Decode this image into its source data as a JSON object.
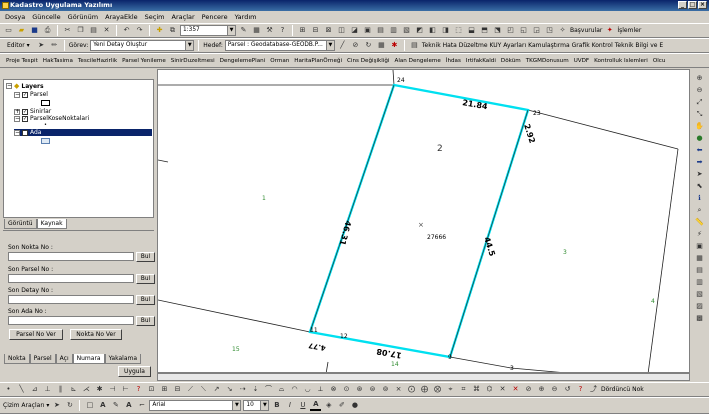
{
  "app": {
    "title": "Kadastro Uygulama Yazılımı"
  },
  "menu": [
    "Dosya",
    "Güncelle",
    "Görünüm",
    "ArayaEkle",
    "Seçim",
    "Araçlar",
    "Pencere",
    "Yardım"
  ],
  "toolbar1": {
    "scale": "1:357",
    "basvurular": "Başvurular",
    "islemler": "İşlemler"
  },
  "toolbar2": {
    "editor": "Editor ▾",
    "gorev_label": "Görev:",
    "gorev_value": "Yeni Detay Oluştur",
    "hedef_label": "Hedef:",
    "hedef_value": "Parsel : Geodatabase-GEODB.P...",
    "links": [
      "Teknik Hata Düzeltme",
      "KUY Ayarları",
      "Kamulaştırma",
      "Grafik Kontrol",
      "Teknik Bilgi ve E"
    ]
  },
  "toolbar3": [
    "Proje Tespit",
    "HakTasima",
    "TescileHazirlik",
    "Parsel Yenileme",
    "SinirDuzeltmesi",
    "DengelemePlani",
    "Orman",
    "HaritaPlanÖrneği",
    "Cins Değişikliği",
    "Alan Dengeleme",
    "İhdas",
    "IrtifakKaldi",
    "Döküm",
    "TKGMDonusum",
    "UVDF",
    "Kontrolluk Islemleri",
    "Olcu"
  ],
  "toc": {
    "root": "Layers",
    "layers": [
      {
        "name": "Parsel",
        "checked": true
      },
      {
        "name": "Sinirlar",
        "checked": true
      },
      {
        "name": "ParselKoseNoktalari",
        "checked": true
      },
      {
        "name": "Ada",
        "checked": true,
        "selected": true
      }
    ],
    "tabs": [
      "Görüntü",
      "Kaynak"
    ]
  },
  "form": {
    "labels": [
      "Son Nokta No :",
      "Son Parsel No :",
      "Son Detay No :",
      "Son Ada No :"
    ],
    "bul": "Bul",
    "parsel_no_ver": "Parsel No Ver",
    "nokta_no_ver": "Nokta No Ver",
    "tabs": [
      "Nokta",
      "Parsel",
      "Açı",
      "Numara",
      "Yakalama"
    ],
    "uygula": "Uygula"
  },
  "map": {
    "parcel_labels": [
      "1",
      "2",
      "3",
      "4",
      "14",
      "15"
    ],
    "points": [
      "24",
      "23",
      "11",
      "12",
      "9",
      "3"
    ],
    "dimensions": {
      "top": "21.84",
      "right_top": "2.92",
      "left": "46.31",
      "right": "44.5",
      "bottom": "17.08",
      "bottom_left": "4.77"
    },
    "area_id": "27666",
    "point_marker": "×"
  },
  "bottom": {
    "dorduncu": "Dördüncü Nok",
    "cizim_araclari": "Çizim Araçları ▾",
    "font": "Arial",
    "size": "10",
    "bold": "B",
    "italic": "I",
    "underline": "U",
    "text_a": "A"
  },
  "colors": {
    "parcel_highlight": "#00e0f0",
    "selection": "#0a246a",
    "parcel_number_green": "#2e8b2e"
  }
}
